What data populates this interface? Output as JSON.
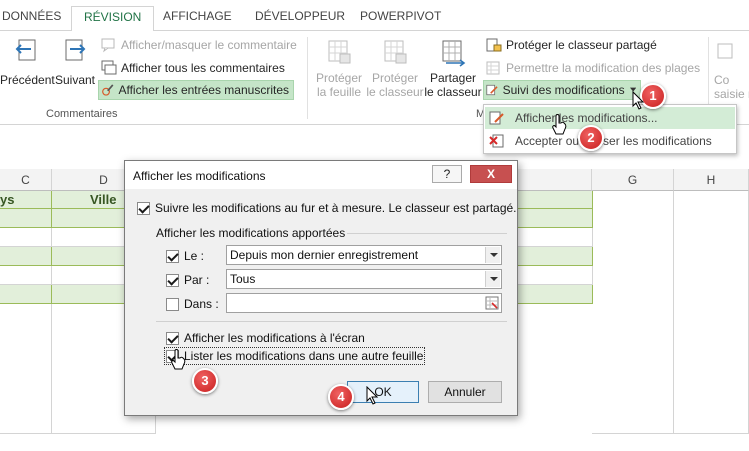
{
  "tabs": [
    {
      "label": "DONNÉES"
    },
    {
      "label": "RÉVISION"
    },
    {
      "label": "AFFICHAGE"
    },
    {
      "label": "DÉVELOPPEUR"
    },
    {
      "label": "POWERPIVOT"
    }
  ],
  "ribbon": {
    "comments_group": {
      "label": "Commentaires",
      "previous": "Précédent",
      "next": "Suivant",
      "show_hide_comment": "Afficher/masquer le commentaire",
      "show_all_comments": "Afficher tous les commentaires",
      "show_ink": "Afficher les entrées manuscrites"
    },
    "changes_group": {
      "label_partial": "M",
      "protect_sheet": [
        "Protéger",
        "la feuille"
      ],
      "protect_workbook": [
        "Protéger",
        "le classeur"
      ],
      "share_workbook": [
        "Partager",
        "le classeur"
      ],
      "protect_shared": "Protéger le classeur partagé",
      "allow_ranges": "Permettre la modification des plages",
      "track_changes": "Suivi des modifications"
    },
    "right_partial": [
      "Co",
      "saisie n"
    ]
  },
  "dropdown": {
    "highlight_changes": "Afficher les modifications...",
    "accept_reject": "Accepter ou refuser les modifications"
  },
  "sheet": {
    "columns": [
      "C",
      "D",
      "G",
      "H"
    ],
    "header_cells": [
      "ys",
      "Ville"
    ]
  },
  "dialog": {
    "title": "Afficher les modifications",
    "help": "?",
    "close": "X",
    "track_while_editing": "Suivre les modifications au fur et à mesure. Le classeur est partagé.",
    "section_label": "Afficher les modifications apportées",
    "when_label": "Le :",
    "when_value": "Depuis mon dernier enregistrement",
    "who_label": "Par :",
    "who_value": "Tous",
    "where_label": "Dans :",
    "where_value": "",
    "on_screen": "Afficher les modifications à l'écran",
    "new_sheet": "Lister les modifications dans une autre feuille",
    "ok": "OK",
    "cancel": "Annuler"
  },
  "badges": [
    "1",
    "2",
    "3",
    "4"
  ],
  "colors": {
    "accent": "#217346",
    "highlight": "#c5e5c8",
    "table_header": "#e2efda",
    "badge": "#d62a2a"
  }
}
